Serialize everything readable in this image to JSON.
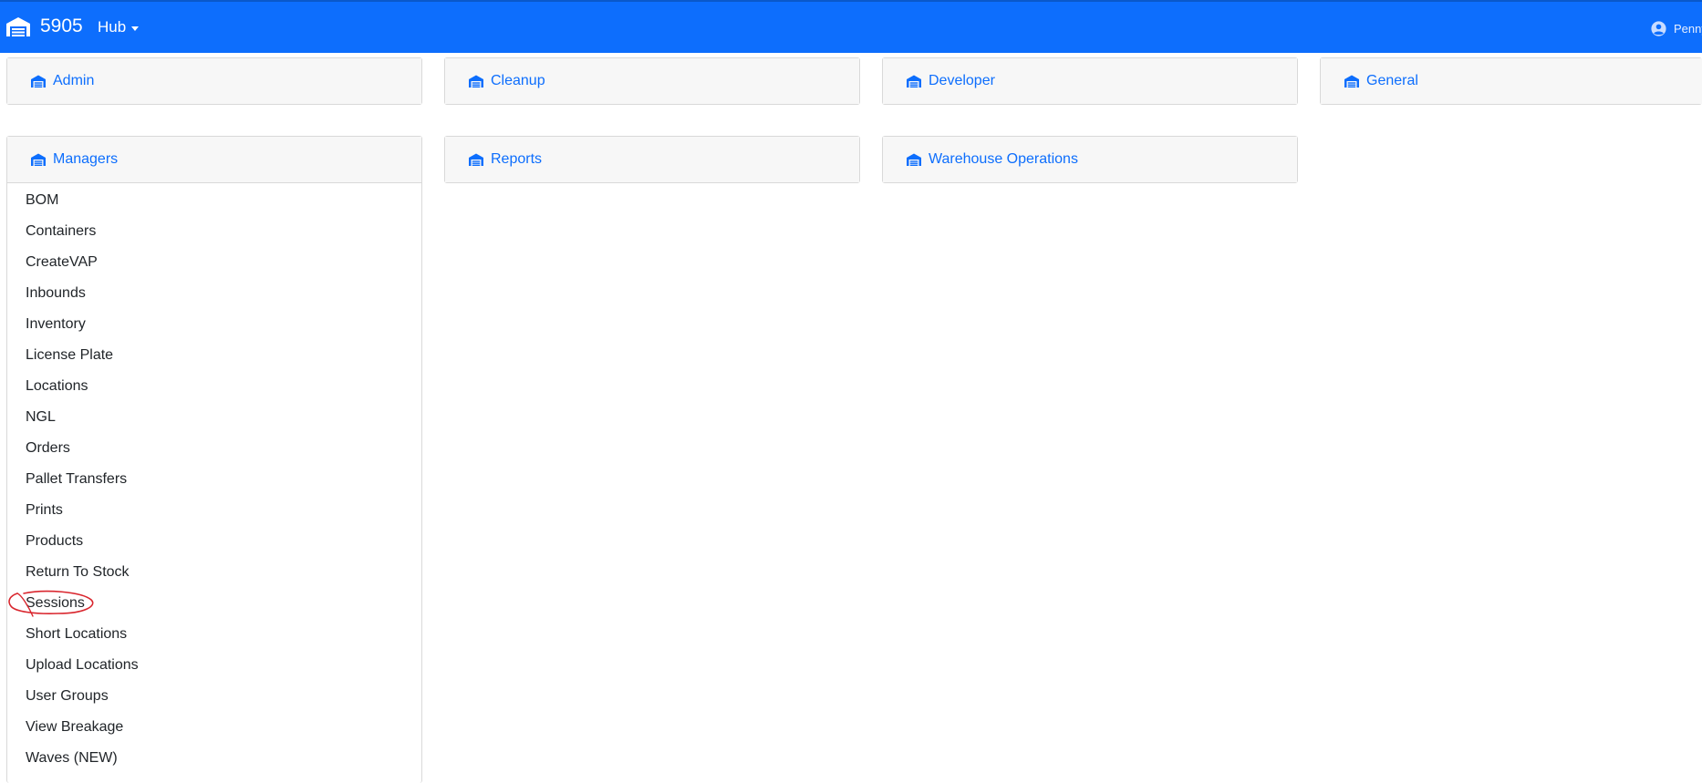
{
  "navbar": {
    "brand": "5905",
    "menu": "Hub",
    "user": "Penny",
    "brand_icon": "warehouse-icon",
    "user_icon": "user-circle-icon"
  },
  "cards": [
    {
      "title": "Admin"
    },
    {
      "title": "Cleanup"
    },
    {
      "title": "Developer"
    },
    {
      "title": "General"
    },
    {
      "title": "Managers"
    },
    {
      "title": "Reports"
    },
    {
      "title": "Warehouse Operations"
    }
  ],
  "managers": {
    "items": [
      "BOM",
      "Containers",
      "CreateVAP",
      "Inbounds",
      "Inventory",
      "License Plate",
      "Locations",
      "NGL",
      "Orders",
      "Pallet Transfers",
      "Prints",
      "Products",
      "Return To Stock",
      "Sessions",
      "Short Locations",
      "Upload Locations",
      "User Groups",
      "View Breakage",
      "Waves (NEW)"
    ]
  },
  "colors": {
    "navbar": "#0d6efd",
    "link": "#0d6efd",
    "annotation": "#d9262e"
  }
}
